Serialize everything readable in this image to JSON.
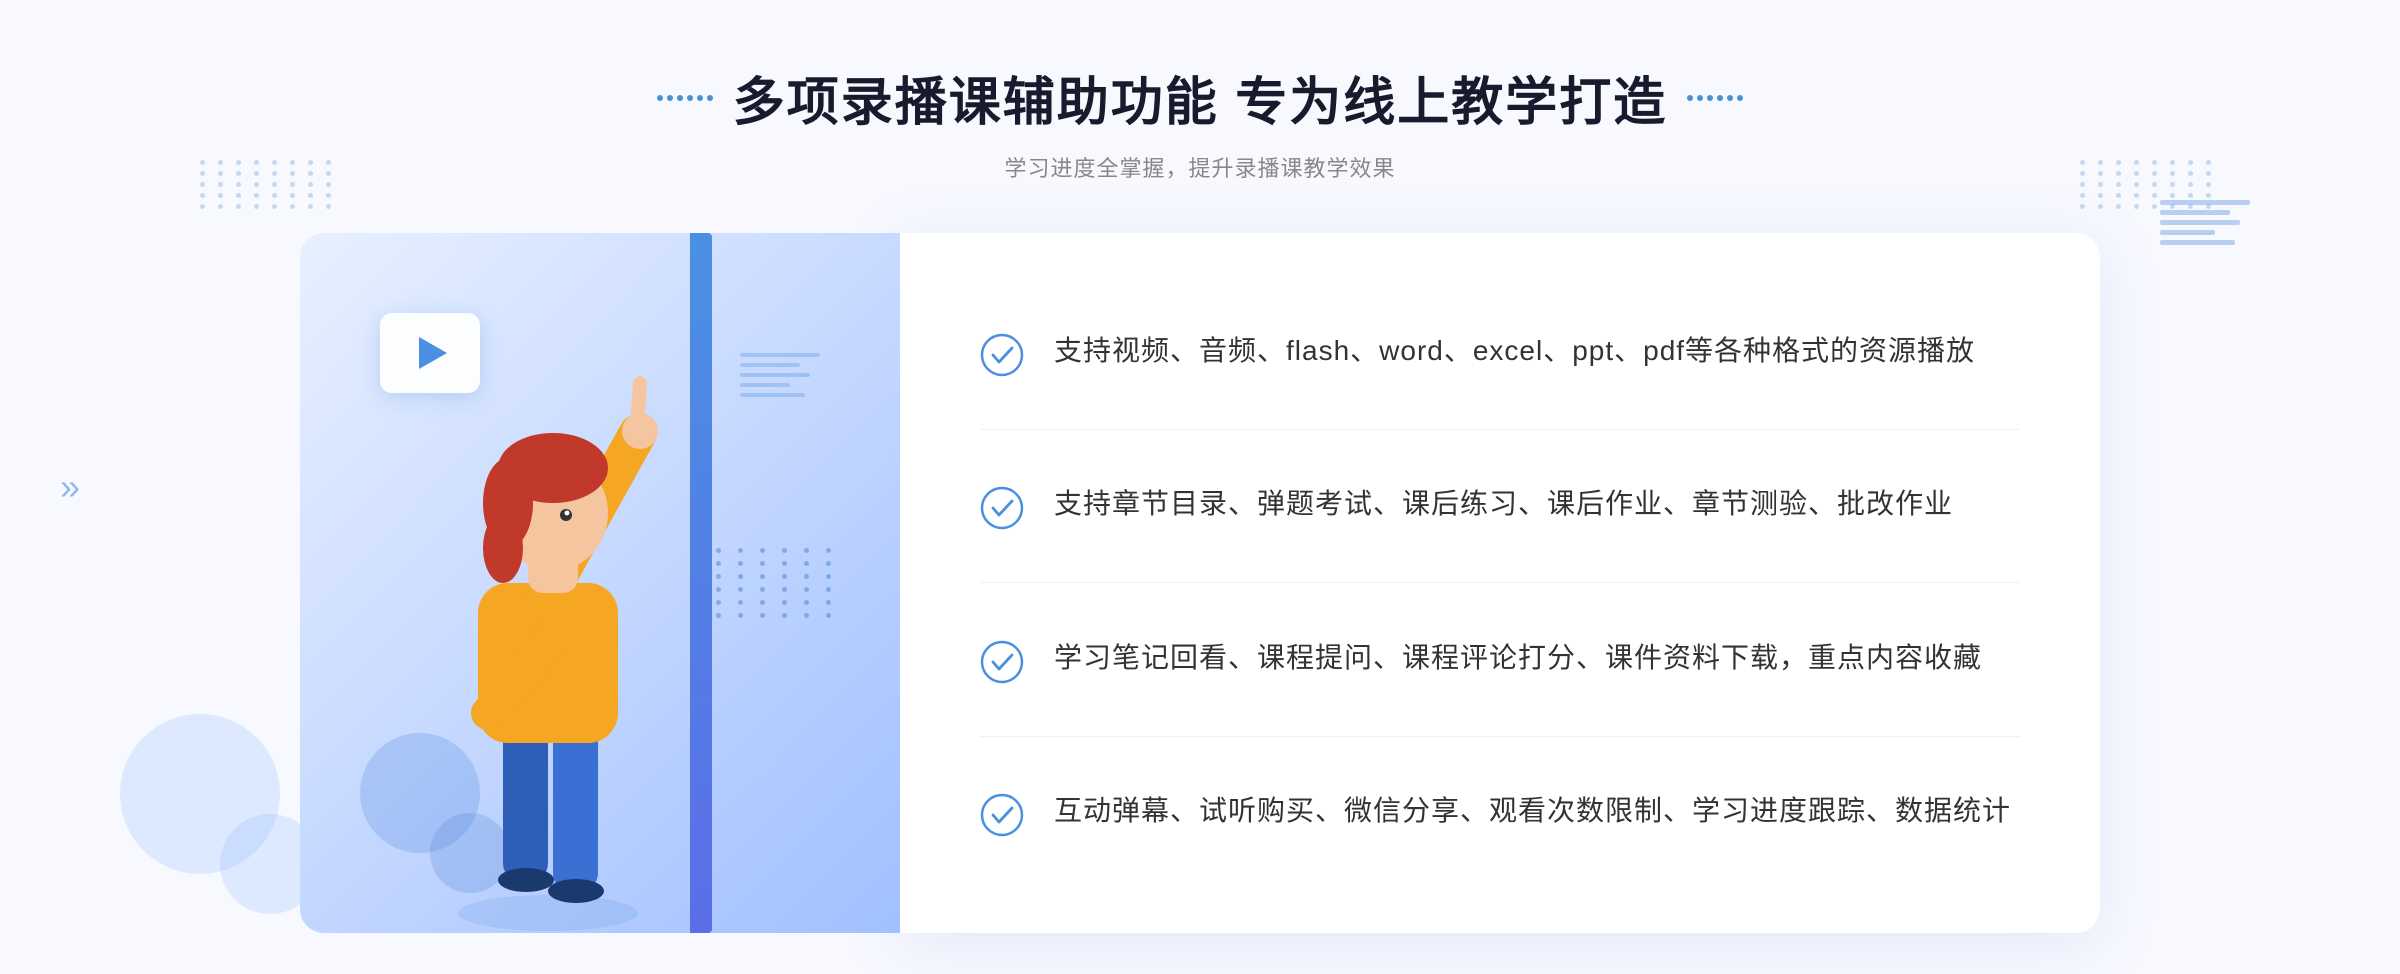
{
  "header": {
    "title": "多项录播课辅助功能 专为线上教学打造",
    "subtitle": "学习进度全掌握，提升录播课教学效果"
  },
  "decorations": {
    "arrow_left": "»",
    "dots_label": "decoration dots"
  },
  "features": [
    {
      "id": 1,
      "text": "支持视频、音频、flash、word、excel、ppt、pdf等各种格式的资源播放"
    },
    {
      "id": 2,
      "text": "支持章节目录、弹题考试、课后练习、课后作业、章节测验、批改作业"
    },
    {
      "id": 3,
      "text": "学习笔记回看、课程提问、课程评论打分、课件资料下载，重点内容收藏"
    },
    {
      "id": 4,
      "text": "互动弹幕、试听购买、微信分享、观看次数限制、学习进度跟踪、数据统计"
    }
  ]
}
